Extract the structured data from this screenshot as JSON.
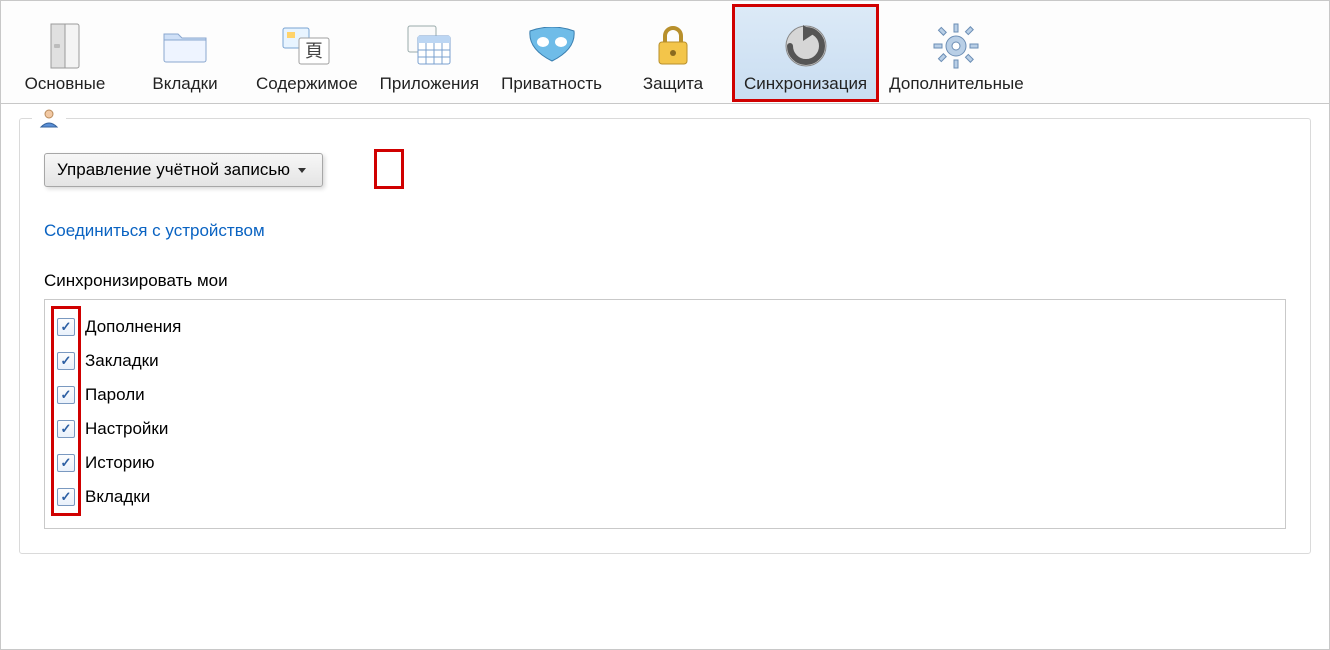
{
  "toolbar": {
    "items": [
      {
        "id": "general",
        "label": "Основные",
        "icon": "general"
      },
      {
        "id": "tabs",
        "label": "Вкладки",
        "icon": "tabs"
      },
      {
        "id": "content",
        "label": "Содержимое",
        "icon": "content"
      },
      {
        "id": "apps",
        "label": "Приложения",
        "icon": "apps"
      },
      {
        "id": "privacy",
        "label": "Приватность",
        "icon": "privacy"
      },
      {
        "id": "security",
        "label": "Защита",
        "icon": "security"
      },
      {
        "id": "sync",
        "label": "Синхронизация",
        "icon": "sync",
        "active": true,
        "highlighted": true
      },
      {
        "id": "advanced",
        "label": "Дополнительные",
        "icon": "advanced"
      }
    ]
  },
  "sync_panel": {
    "account_button_label": "Управление учётной записью",
    "account_button_highlight_caret": true,
    "connect_link": "Соединиться с устройством",
    "sync_my_label": "Синхронизировать мои",
    "items": [
      {
        "label": "Дополнения",
        "checked": true
      },
      {
        "label": "Закладки",
        "checked": true
      },
      {
        "label": "Пароли",
        "checked": true
      },
      {
        "label": "Настройки",
        "checked": true
      },
      {
        "label": "Историю",
        "checked": true
      },
      {
        "label": "Вкладки",
        "checked": true
      }
    ],
    "checkbox_column_highlighted": true
  },
  "colors": {
    "highlight": "#d00000",
    "link": "#0a63c2"
  }
}
